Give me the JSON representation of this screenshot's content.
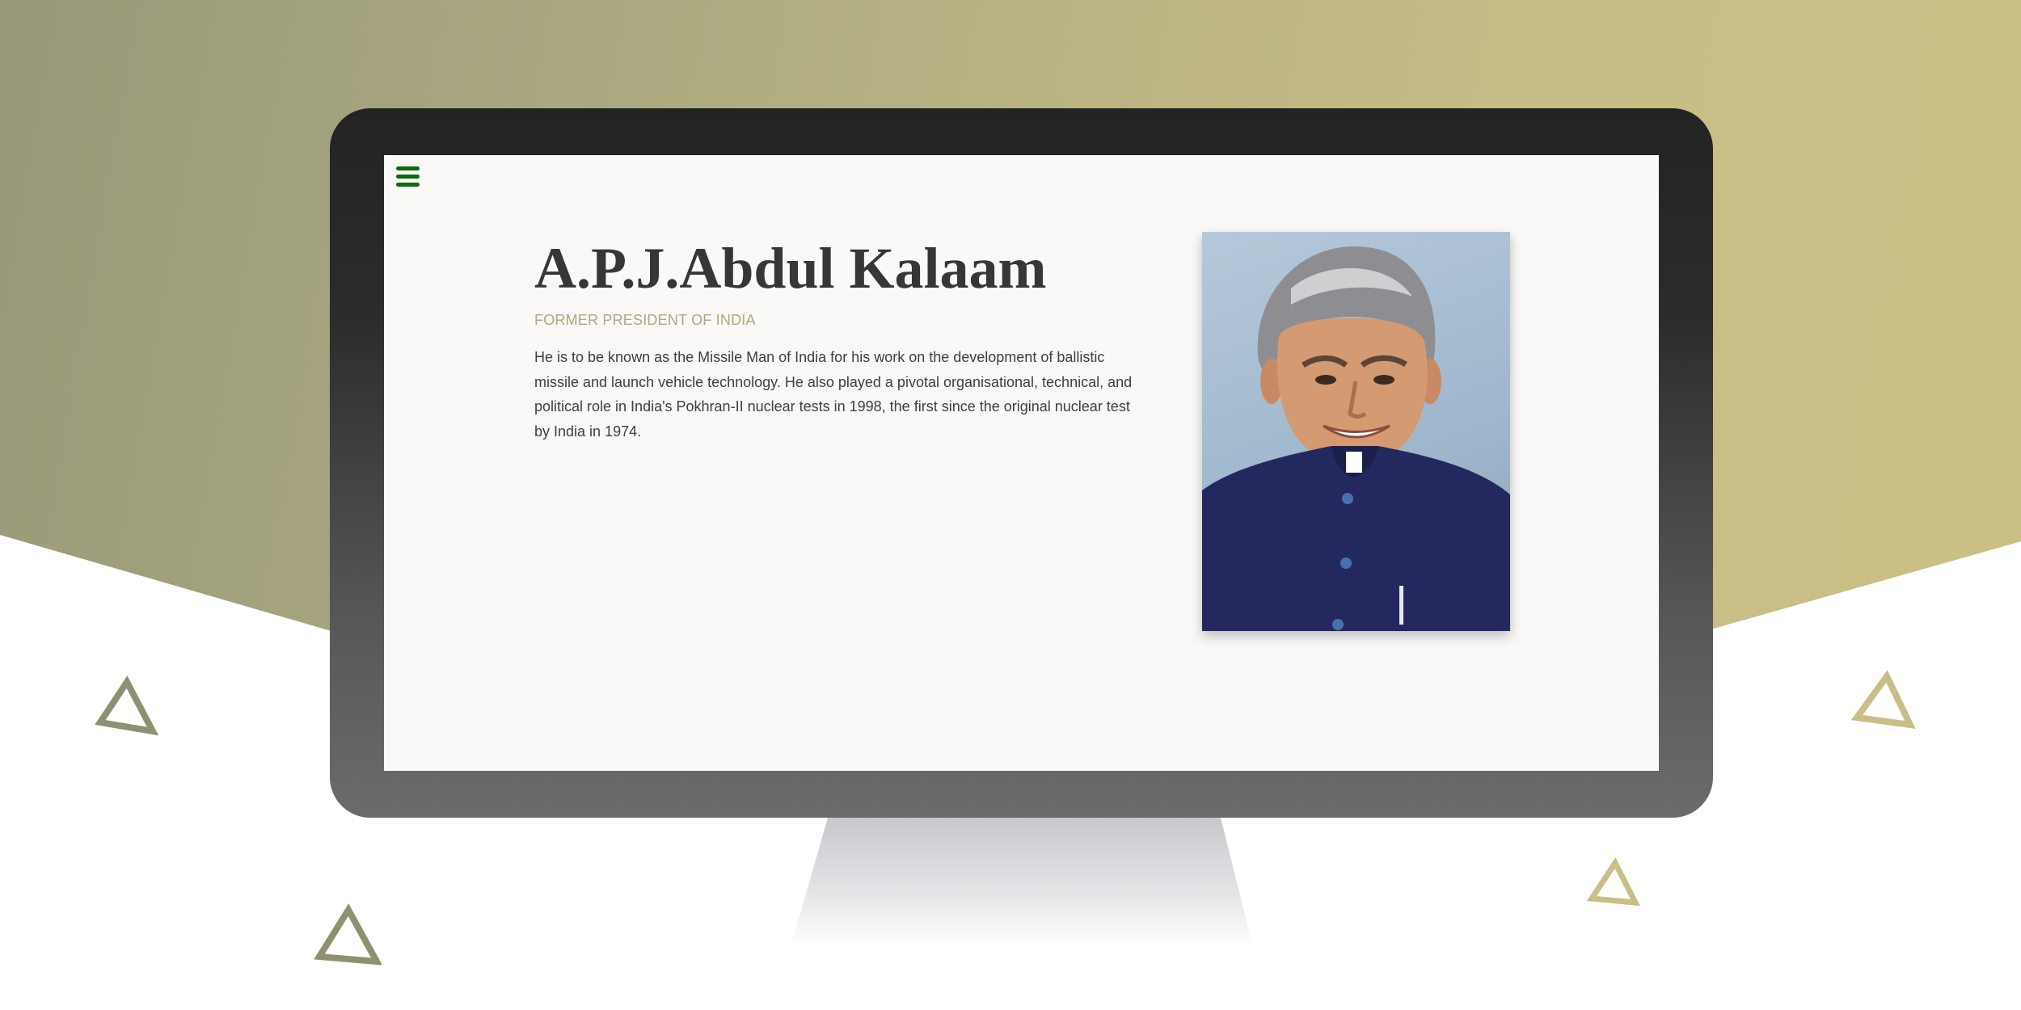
{
  "hero": {
    "title": "A.P.J.Abdul Kalaam",
    "subtitle": "FORMER PRESIDENT OF INDIA",
    "description": "He is to be known as the Missile Man of India for his work on the development of ballistic missile and launch vehicle technology. He also played a pivotal organisational, technical, and political role in India's Pokhran-II nuclear tests in 1998, the first since the original nuclear test by India in 1974."
  },
  "menu": {
    "icon": "hamburger-menu-icon"
  },
  "portrait": {
    "subject": "portrait-photo"
  },
  "colors": {
    "menu_icon": "#0e6a0e",
    "title": "#363636",
    "subtitle": "#aeaa7a",
    "body_text": "#3e3e3e",
    "screen_background": "#faf9f8",
    "band_left": "#98997a",
    "band_right": "#cbc085",
    "triangle_dark": "#8f9072",
    "triangle_light": "#c8be88"
  }
}
